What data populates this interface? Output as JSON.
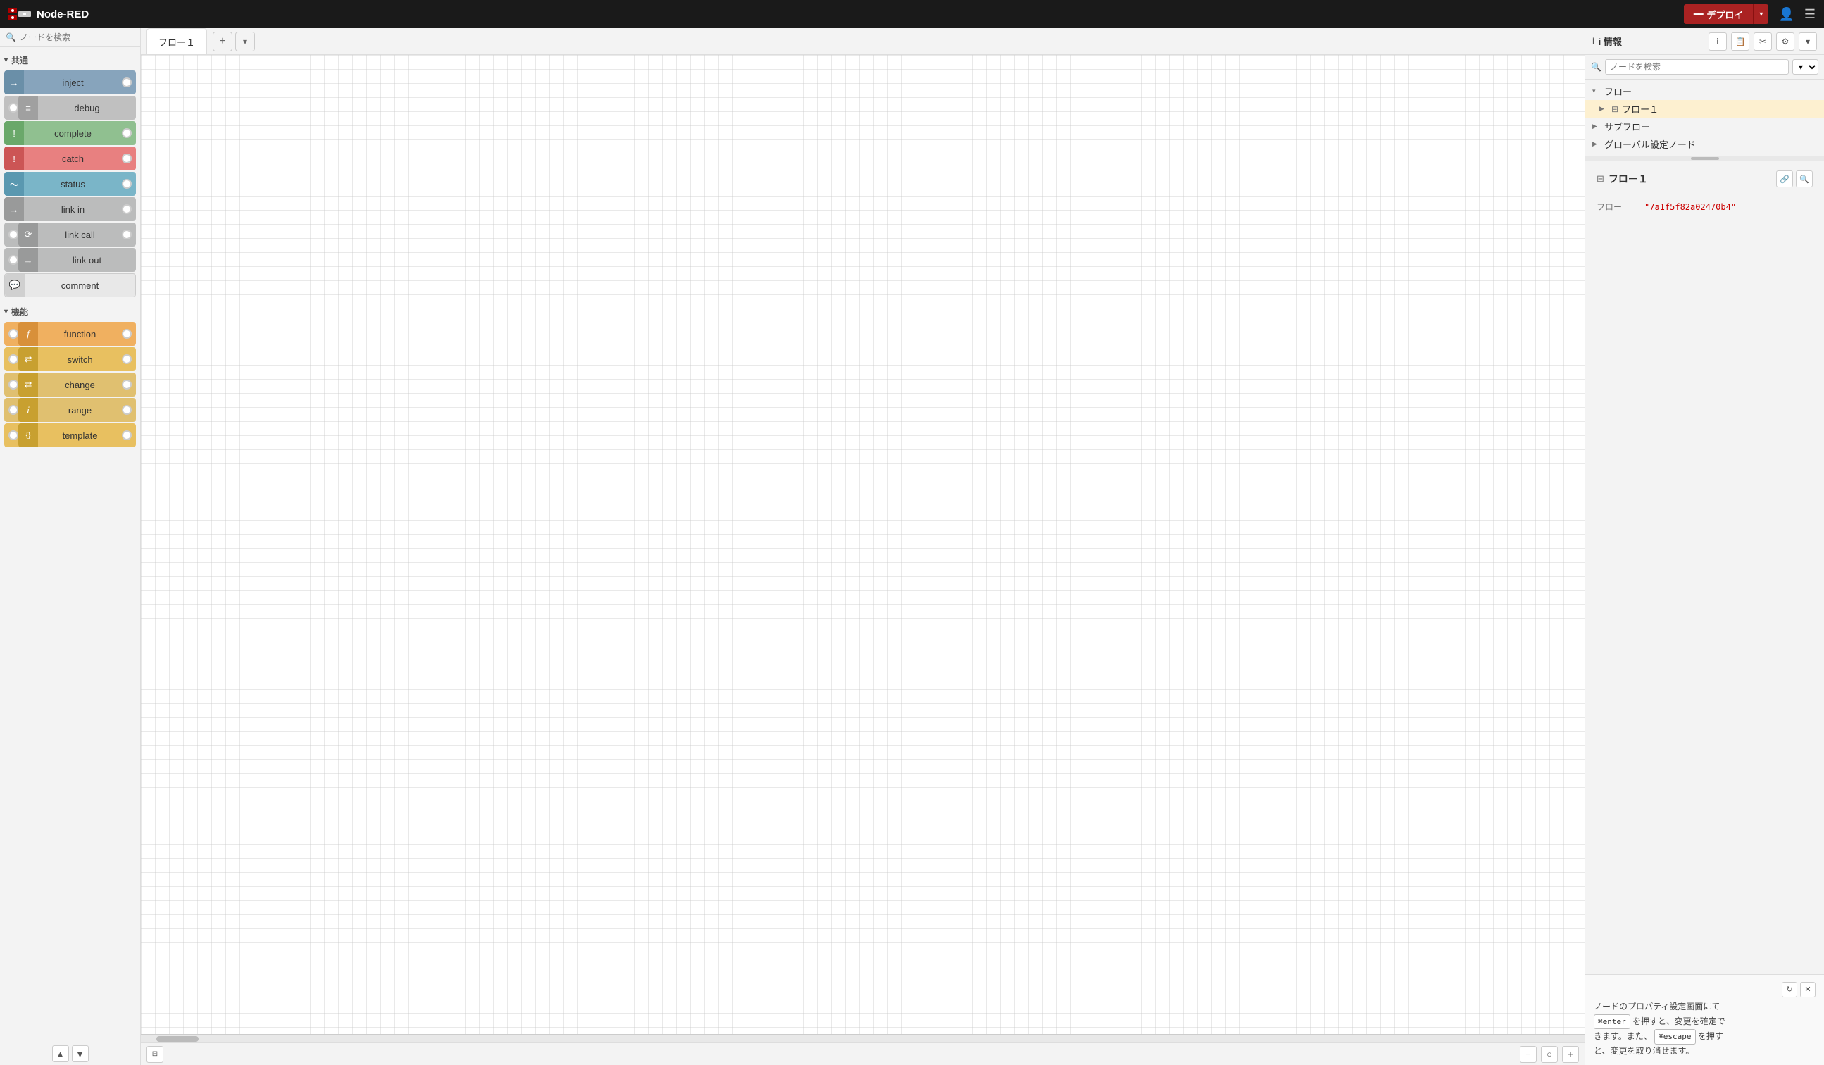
{
  "topbar": {
    "title": "Node-RED",
    "deploy_label": "デプロイ"
  },
  "sidebar_left": {
    "search_placeholder": "ノードを検索",
    "sections": [
      {
        "id": "common",
        "label": "共通",
        "nodes": [
          {
            "id": "inject",
            "label": "inject",
            "color": "node-inject",
            "icon": "→",
            "has_left_port": false,
            "has_right_port": true
          },
          {
            "id": "debug",
            "label": "debug",
            "color": "node-debug",
            "icon": "≡",
            "has_left_port": true,
            "has_right_port": false
          },
          {
            "id": "complete",
            "label": "complete",
            "color": "node-complete",
            "icon": "!",
            "has_left_port": false,
            "has_right_port": true
          },
          {
            "id": "catch",
            "label": "catch",
            "color": "node-catch",
            "icon": "!",
            "has_left_port": false,
            "has_right_port": true
          },
          {
            "id": "status",
            "label": "status",
            "color": "node-status",
            "icon": "~",
            "has_left_port": false,
            "has_right_port": true
          },
          {
            "id": "linkin",
            "label": "link in",
            "color": "node-linkin",
            "icon": "→",
            "has_left_port": false,
            "has_right_port": true
          },
          {
            "id": "linkcall",
            "label": "link call",
            "color": "node-linkcall",
            "icon": "⟳",
            "has_left_port": true,
            "has_right_port": true
          },
          {
            "id": "linkout",
            "label": "link out",
            "color": "node-linkout",
            "icon": "→",
            "has_left_port": true,
            "has_right_port": false
          },
          {
            "id": "comment",
            "label": "comment",
            "color": "node-comment",
            "icon": "💬",
            "has_left_port": false,
            "has_right_port": false
          }
        ]
      },
      {
        "id": "function",
        "label": "機能",
        "nodes": [
          {
            "id": "function",
            "label": "function",
            "color": "node-function",
            "icon": "f",
            "has_left_port": true,
            "has_right_port": true
          },
          {
            "id": "switch",
            "label": "switch",
            "color": "node-switch",
            "icon": "⇄",
            "has_left_port": true,
            "has_right_port": true
          },
          {
            "id": "change",
            "label": "change",
            "color": "node-change",
            "icon": "⇄",
            "has_left_port": true,
            "has_right_port": true
          },
          {
            "id": "range",
            "label": "range",
            "color": "node-range",
            "icon": "i",
            "has_left_port": true,
            "has_right_port": true
          },
          {
            "id": "template",
            "label": "template",
            "color": "node-template",
            "icon": "{}",
            "has_left_port": true,
            "has_right_port": true
          }
        ]
      }
    ]
  },
  "canvas": {
    "tab_label": "フロー１",
    "add_tooltip": "+",
    "dropdown_tooltip": "▾"
  },
  "panel_right": {
    "info_label": "i 情報",
    "search_placeholder": "ノードを検索",
    "tree": {
      "flow_section": "フロー",
      "flow1_label": "フロー１",
      "subflow_label": "サブフロー",
      "global_config_label": "グローバル設定ノード"
    },
    "detail": {
      "title": "フロー１",
      "flow_label": "フロー",
      "flow_value": "\"7a1f5f82a02470b4\""
    },
    "hint": {
      "line1": "ノードのプロパティ設定画面にて",
      "enter_key": "⌘enter",
      "line2": "を押すと、変更を確定で",
      "line3": "きます。また、",
      "escape_key": "⌘escape",
      "line4": "を押す",
      "line5": "と、変更を取り消せます。"
    }
  }
}
